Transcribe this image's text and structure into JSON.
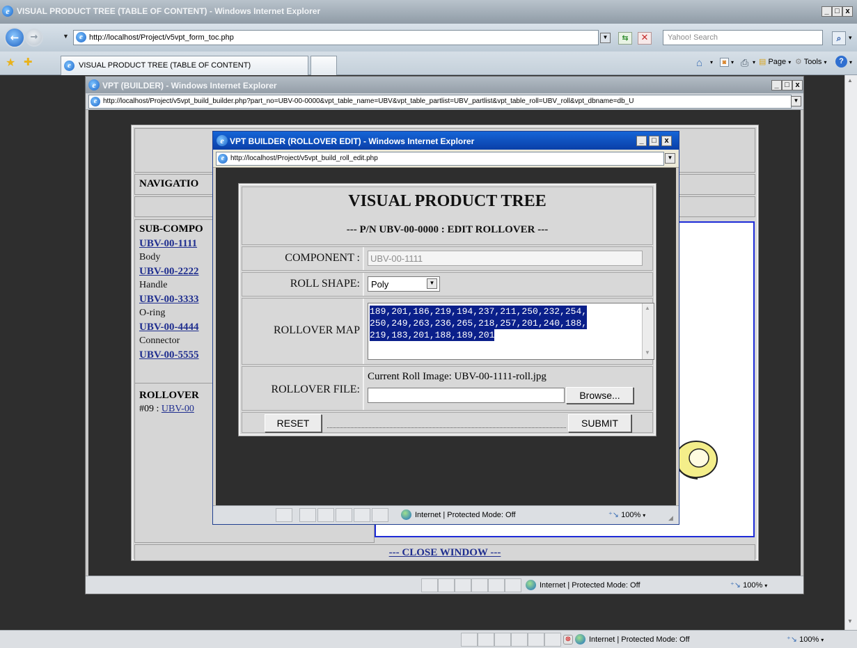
{
  "outer": {
    "title": "VISUAL PRODUCT TREE (TABLE OF CONTENT) - Windows Internet Explorer",
    "address": "http://localhost/Project/v5vpt_form_toc.php",
    "search_placeholder": "Yahoo! Search",
    "tab_label": "VISUAL PRODUCT TREE (TABLE OF CONTENT)",
    "cmd_page": "Page",
    "cmd_tools": "Tools",
    "status_zone": "Internet | Protected Mode: Off",
    "zoom": "100%"
  },
  "builder": {
    "title": "VPT (BUILDER) - Windows Internet Explorer",
    "address": "http://localhost/Project/v5vpt_build_builder.php?part_no=UBV-00-0000&vpt_table_name=UBV&vpt_table_partlist=UBV_partlist&vpt_table_roll=UBV_roll&vpt_dbname=db_U",
    "navigation_heading": "NAVIGATIO",
    "subcomponents_heading": "SUB-COMPO",
    "parts": [
      {
        "number": "UBV-00-1111",
        "name": "Body"
      },
      {
        "number": "UBV-00-2222",
        "name": "Handle"
      },
      {
        "number": "UBV-00-3333",
        "name": "O-ring"
      },
      {
        "number": "UBV-00-4444",
        "name": "Connector"
      },
      {
        "number": "UBV-00-5555",
        "name": ""
      }
    ],
    "rollover_heading": "ROLLOVER",
    "rollover_prefix": "#09 : ",
    "rollover_link": "UBV-00",
    "close_window": "--- CLOSE WINDOW ---",
    "status_zone": "Internet | Protected Mode: Off",
    "zoom": "100%"
  },
  "dialog": {
    "title": "VPT BUILDER (ROLLOVER EDIT) - Windows Internet Explorer",
    "address": "http://localhost/Project/v5vpt_build_roll_edit.php",
    "heading": "VISUAL PRODUCT TREE",
    "subheading": "--- P/N UBV-00-0000 : EDIT ROLLOVER ---",
    "component_label": "COMPONENT :",
    "component_value": "UBV-00-1111",
    "roll_shape_label": "ROLL SHAPE:",
    "roll_shape_value": "Poly",
    "rollover_map_label": "ROLLOVER MAP",
    "rollover_map_lines": [
      "189,201,186,219,194,237,211,250,232,254,",
      "250,249,263,236,265,218,257,201,240,188,",
      "219,183,201,188,189,201"
    ],
    "rollover_file_label": "ROLLOVER FILE:",
    "current_roll_image": "Current Roll Image: UBV-00-1111-roll.jpg",
    "browse_label": "Browse...",
    "reset_label": "RESET",
    "submit_label": "SUBMIT",
    "status_zone": "Internet | Protected Mode: Off",
    "zoom": "100%"
  }
}
